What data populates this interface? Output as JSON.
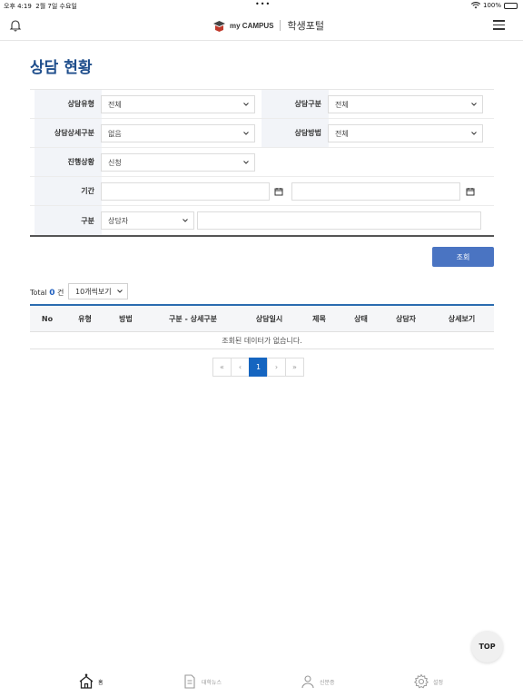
{
  "status_bar": {
    "time": "오후 4:19",
    "date": "2월 7일 수요일",
    "battery": "100%"
  },
  "header": {
    "brand": "my CAMPUS",
    "portal": "학생포털"
  },
  "page": {
    "title": "상담 현황"
  },
  "form": {
    "type_label": "상담유형",
    "type_value": "전체",
    "category_label": "상담구분",
    "category_value": "전체",
    "subcategory_label": "상담상세구분",
    "subcategory_value": "없음",
    "method_label": "상담방법",
    "method_value": "전체",
    "status_label": "진행상황",
    "status_value": "신청",
    "period_label": "기간",
    "division_label": "구분",
    "division_value": "상담자"
  },
  "search_button": "조회",
  "list": {
    "total_prefix": "Total",
    "total_count": "0",
    "total_unit": "건",
    "per_page": "10개씩보기",
    "columns": [
      "No",
      "유형",
      "방법",
      "구분 - 상세구분",
      "상담일시",
      "제목",
      "상태",
      "상담자",
      "상세보기"
    ],
    "empty_message": "조회된 데이터가 없습니다."
  },
  "pagination": {
    "first": "«",
    "prev": "‹",
    "current": "1",
    "next": "›",
    "last": "»"
  },
  "top_button": "TOP",
  "tabbar": {
    "home": "홈",
    "news": "대학뉴스",
    "idcard": "신분증",
    "settings": "설정"
  },
  "colors": {
    "title": "#1f4e8c",
    "accent": "#4a74c2",
    "active_page": "#1565c0",
    "count": "#1f5fbf"
  }
}
